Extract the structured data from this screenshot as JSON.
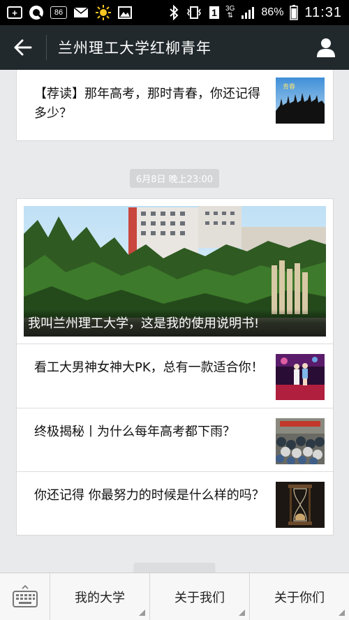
{
  "status_bar": {
    "icons": [
      "plus-box-icon",
      "q-app-icon",
      "notification-86-icon",
      "mail-icon",
      "sun-weather-icon",
      "gallery-icon",
      "bluetooth-icon",
      "vibrate-icon",
      "sim-icon",
      "network-3g-icon",
      "signal-icon",
      "battery-icon"
    ],
    "badge": "86",
    "sim": "1",
    "network": "3G",
    "battery": "86%",
    "time": "11:31"
  },
  "header": {
    "title": "兰州理工大学红柳青年",
    "back_icon": "back-arrow-icon",
    "profile_icon": "person-icon"
  },
  "messages": [
    {
      "articles": [
        {
          "title": "【荐读】那年高考，那时青春，你还记得多少？",
          "thumb": "graduation-silhouette-thumbnail"
        }
      ]
    },
    {
      "timestamp": "6月8日 晚上23:00",
      "cover": {
        "title": "我叫兰州理工大学，这是我的使用说明书!",
        "image": "campus-buildings-cover"
      },
      "articles": [
        {
          "title": "看工大男神女神大PK，总有一款适合你！",
          "thumb": "stage-couple-thumbnail"
        },
        {
          "title": "终极揭秘丨为什么每年高考都下雨？",
          "thumb": "umbrellas-crowd-thumbnail"
        },
        {
          "title": "你还记得 你最努力的时候是什么样的吗？",
          "thumb": "hourglass-thumbnail"
        }
      ]
    }
  ],
  "bottom_menu": {
    "keyboard_icon": "keyboard-icon",
    "items": [
      "我的大学",
      "关于我们",
      "关于你们"
    ]
  },
  "colors": {
    "header_bg": "#22292c",
    "page_bg": "#e9eaec",
    "timestamp_bg": "#d4d5d7"
  }
}
